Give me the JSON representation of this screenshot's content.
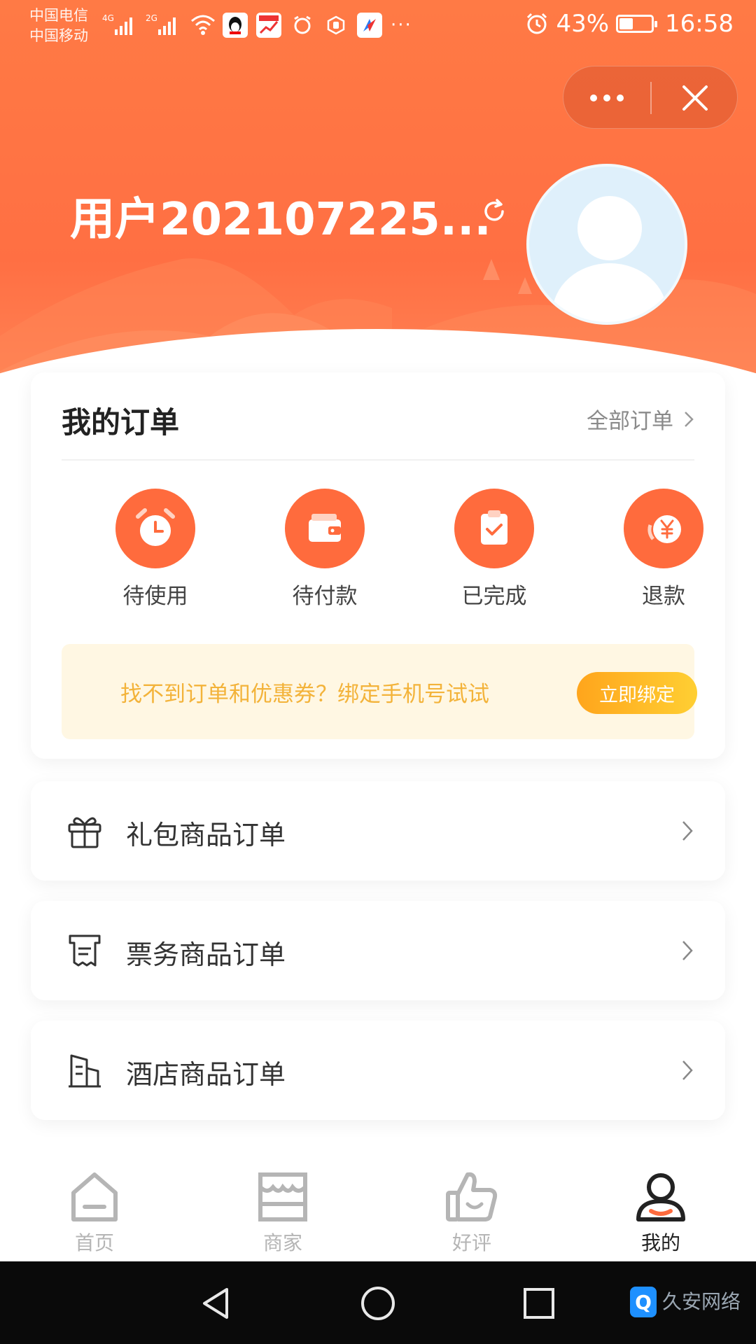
{
  "colors": {
    "accent": "#ff6f43",
    "icon_circle": "#ff6b3d",
    "banner_bg": "#fff7e3",
    "banner_text": "#f3b33a",
    "banner_button": "#ffbe26",
    "tab_inactive": "#b5b5b5",
    "tab_active": "#222222"
  },
  "status_bar": {
    "carrier_1": "中国电信",
    "carrier_2": "中国移动",
    "net_1": "4G",
    "net_2": "2G",
    "battery_percent": "43%",
    "battery_level": 0.43,
    "time": "16:58",
    "more": "···"
  },
  "user": {
    "name": "用户202107225..."
  },
  "orders": {
    "title": "我的订单",
    "all_label": "全部订单",
    "items": [
      {
        "label": "待使用",
        "icon": "alarm-clock-icon"
      },
      {
        "label": "待付款",
        "icon": "wallet-icon"
      },
      {
        "label": "已完成",
        "icon": "clipboard-check-icon"
      },
      {
        "label": "退款",
        "icon": "refund-yen-icon"
      }
    ],
    "banner_text": "找不到订单和优惠券？绑定手机号试试",
    "banner_button": "立即绑定"
  },
  "order_types": [
    {
      "label": "礼包商品订单",
      "icon": "gift-icon"
    },
    {
      "label": "票务商品订单",
      "icon": "ticket-receipt-icon"
    },
    {
      "label": "酒店商品订单",
      "icon": "hotel-building-icon"
    }
  ],
  "tabbar": {
    "items": [
      {
        "label": "首页",
        "icon": "home-icon",
        "active": false
      },
      {
        "label": "商家",
        "icon": "shop-icon",
        "active": false
      },
      {
        "label": "好评",
        "icon": "thumbs-up-icon",
        "active": false
      },
      {
        "label": "我的",
        "icon": "profile-icon",
        "active": true
      }
    ]
  },
  "watermark": {
    "logo": "Q",
    "text": "久安网络"
  }
}
